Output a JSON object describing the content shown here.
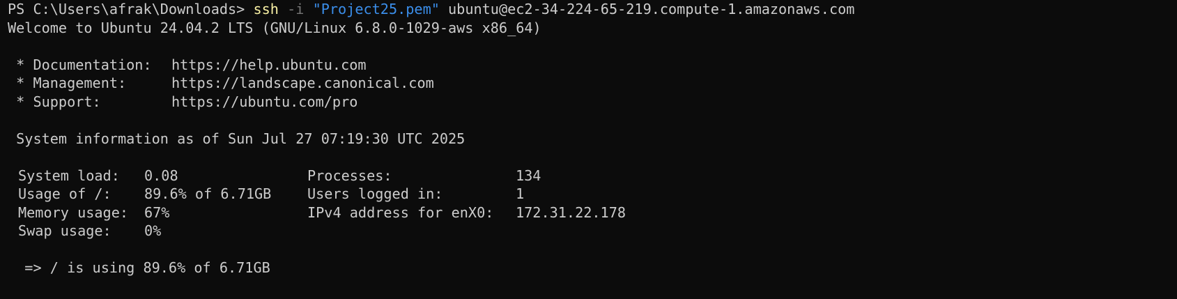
{
  "prompt": {
    "ps_prefix": "PS C:\\Users\\afrak\\Downloads> ",
    "command": "ssh",
    "flag": "-i",
    "keyfile": "\"Project25.pem\"",
    "host": "ubuntu@ec2-34-224-65-219.compute-1.amazonaws.com"
  },
  "welcome": "Welcome to Ubuntu 24.04.2 LTS (GNU/Linux 6.8.0-1029-aws x86_64)",
  "links": [
    {
      "label": " * Documentation:",
      "url": "https://help.ubuntu.com"
    },
    {
      "label": " * Management:",
      "url": "https://landscape.canonical.com"
    },
    {
      "label": " * Support:",
      "url": "https://ubuntu.com/pro"
    }
  ],
  "sysinfo_header": " System information as of Sun Jul 27 07:19:30 UTC 2025",
  "stats": [
    {
      "label": "System load:",
      "value": "0.08",
      "r_label": "Processes:",
      "r_value": "134"
    },
    {
      "label": "Usage of /:",
      "value": "89.6% of 6.71GB",
      "r_label": "Users logged in:",
      "r_value": "1"
    },
    {
      "label": "Memory usage:",
      "value": "67%",
      "r_label": "IPv4 address for enX0:",
      "r_value": "172.31.22.178"
    },
    {
      "label": "Swap usage:",
      "value": "0%",
      "r_label": "",
      "r_value": ""
    }
  ],
  "usage_warning": "  => / is using 89.6% of 6.71GB"
}
